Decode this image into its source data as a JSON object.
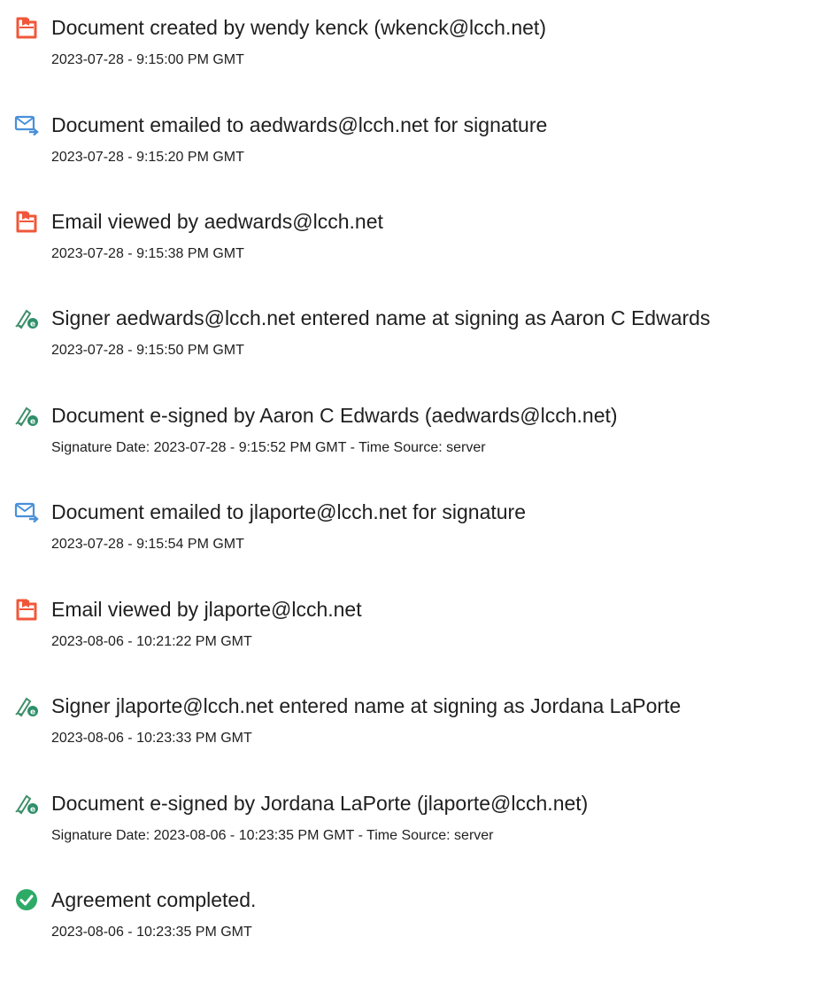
{
  "events": [
    {
      "icon": "document-icon",
      "title": "Document created by wendy kenck (wkenck@lcch.net)",
      "timestamp": "2023-07-28 - 9:15:00 PM GMT"
    },
    {
      "icon": "email-sent-icon",
      "title": "Document emailed to aedwards@lcch.net for signature",
      "timestamp": "2023-07-28 - 9:15:20 PM GMT"
    },
    {
      "icon": "document-icon",
      "title": "Email viewed by aedwards@lcch.net",
      "timestamp": "2023-07-28 - 9:15:38 PM GMT"
    },
    {
      "icon": "pen-signature-icon",
      "title": "Signer aedwards@lcch.net entered name at signing as Aaron C Edwards",
      "timestamp": "2023-07-28 - 9:15:50 PM GMT"
    },
    {
      "icon": "pen-signature-icon",
      "title": "Document e-signed by Aaron C Edwards (aedwards@lcch.net)",
      "timestamp": "Signature Date: 2023-07-28 - 9:15:52 PM GMT - Time Source: server"
    },
    {
      "icon": "email-sent-icon",
      "title": "Document emailed to jlaporte@lcch.net for signature",
      "timestamp": "2023-07-28 - 9:15:54 PM GMT"
    },
    {
      "icon": "document-icon",
      "title": "Email viewed by jlaporte@lcch.net",
      "timestamp": "2023-08-06 - 10:21:22 PM GMT"
    },
    {
      "icon": "pen-signature-icon",
      "title": "Signer jlaporte@lcch.net entered name at signing as Jordana LaPorte",
      "timestamp": "2023-08-06 - 10:23:33 PM GMT"
    },
    {
      "icon": "pen-signature-icon",
      "title": "Document e-signed by Jordana LaPorte (jlaporte@lcch.net)",
      "timestamp": "Signature Date: 2023-08-06 - 10:23:35 PM GMT - Time Source: server"
    },
    {
      "icon": "checkmark-circle-icon",
      "title": "Agreement completed.",
      "timestamp": "2023-08-06 - 10:23:35 PM GMT"
    }
  ],
  "colors": {
    "document_icon": "#f0573a",
    "email_icon": "#4a90d9",
    "pen_icon": "#3f8f6a",
    "check_icon": "#2eaa67"
  }
}
